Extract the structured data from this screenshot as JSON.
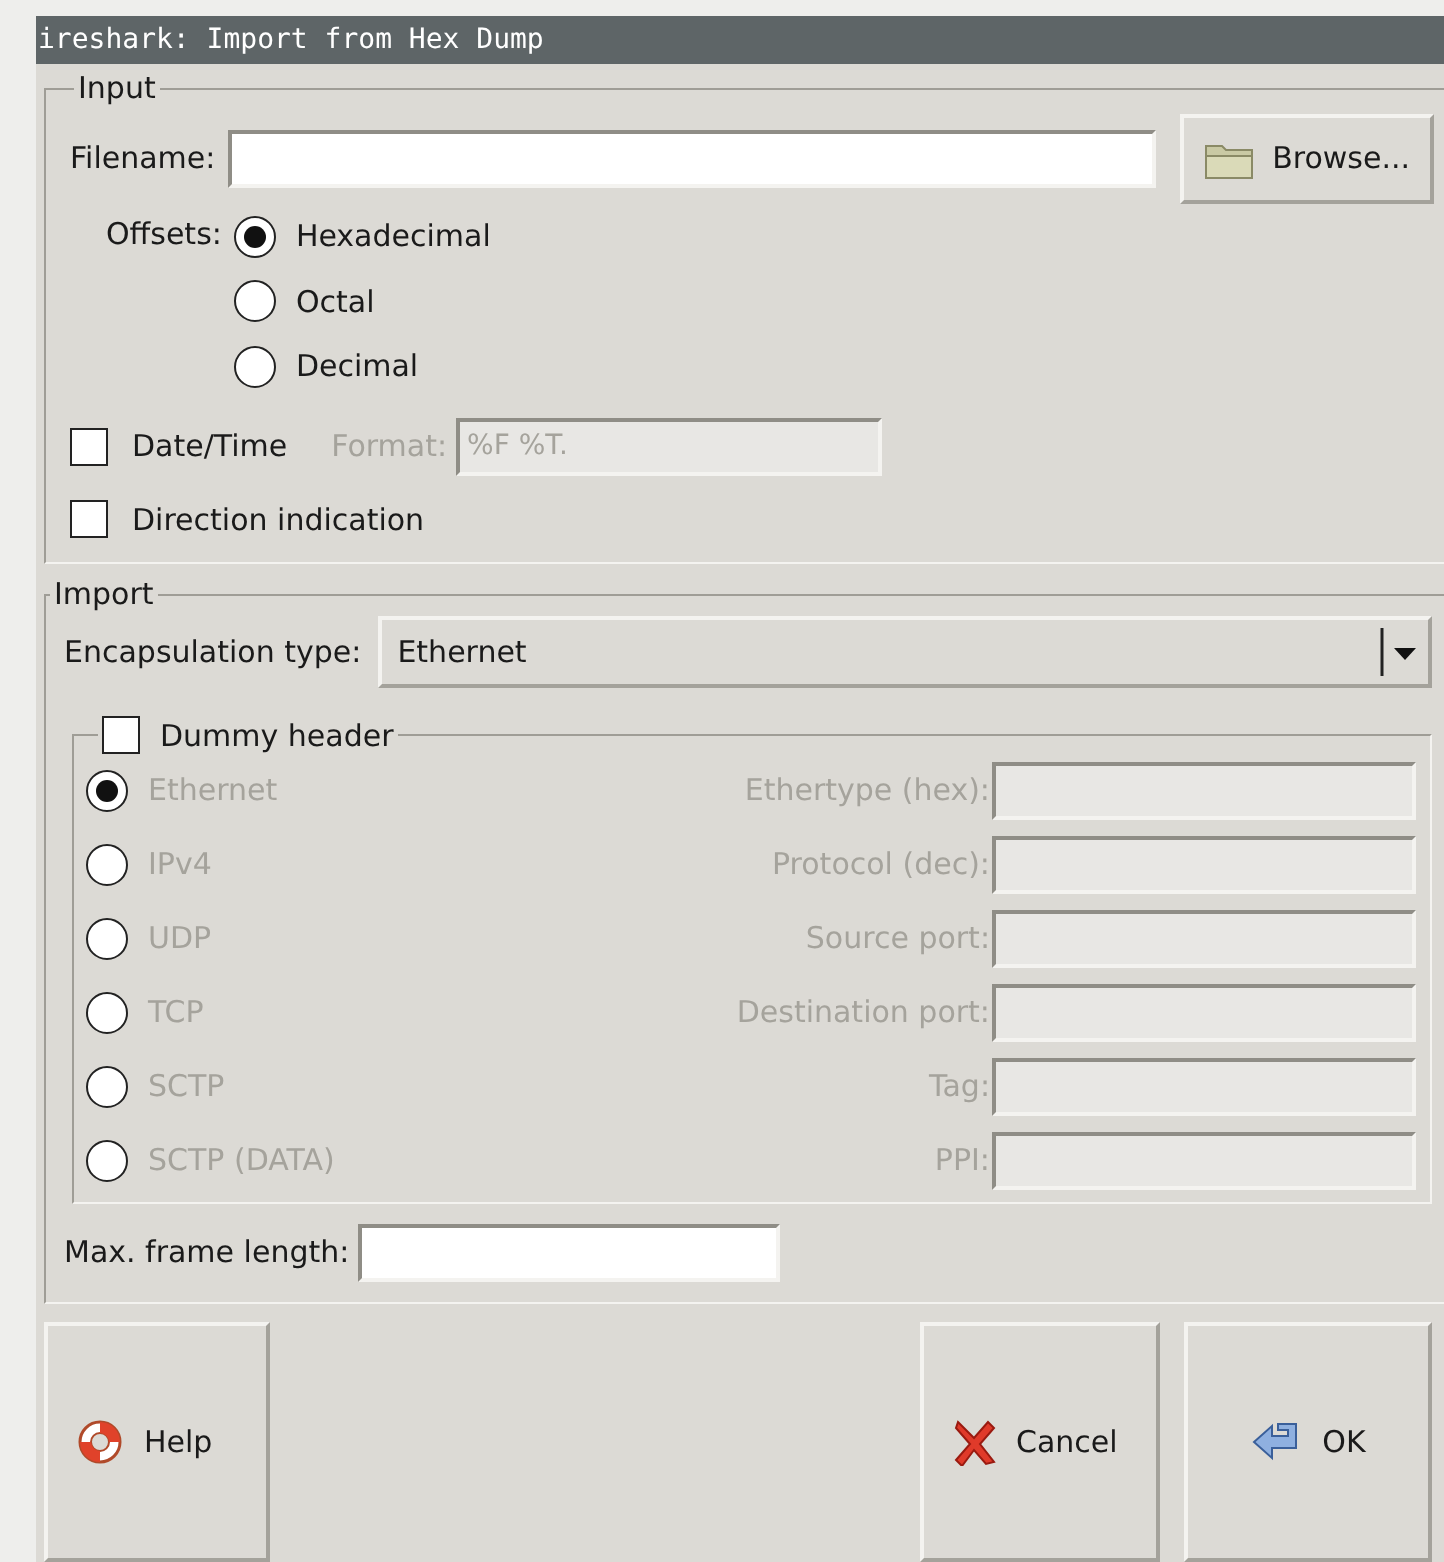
{
  "window": {
    "title": "ireshark: Import from Hex Dump"
  },
  "input": {
    "legend": "Input",
    "filename_label": "Filename:",
    "browse_button": "Browse...",
    "offsets": {
      "label": "Offsets:",
      "options": [
        {
          "label": "Hexadecimal",
          "selected": true
        },
        {
          "label": "Octal",
          "selected": false
        },
        {
          "label": "Decimal",
          "selected": false
        }
      ]
    },
    "date_time": {
      "label": "Date/Time",
      "checked": false
    },
    "format": {
      "label": "Format:",
      "value": "%F %T.",
      "disabled": true
    },
    "direction_indication": {
      "label": "Direction indication",
      "checked": false
    }
  },
  "import": {
    "legend": "Import",
    "encapsulation": {
      "label": "Encapsulation type:",
      "value": "Ethernet"
    },
    "dummy_header": {
      "label": "Dummy header",
      "checked": false,
      "rows": [
        {
          "protocol": "Ethernet",
          "selected": true,
          "field": "Ethertype (hex):",
          "disabled": true
        },
        {
          "protocol": "IPv4",
          "selected": false,
          "field": "Protocol (dec):",
          "disabled": true
        },
        {
          "protocol": "UDP",
          "selected": false,
          "field": "Source port:",
          "disabled": true
        },
        {
          "protocol": "TCP",
          "selected": false,
          "field": "Destination port:",
          "disabled": true
        },
        {
          "protocol": "SCTP",
          "selected": false,
          "field": "Tag:",
          "disabled": true
        },
        {
          "protocol": "SCTP (DATA)",
          "selected": false,
          "field": "PPI:",
          "disabled": true
        }
      ]
    },
    "max_frame_length": {
      "label": "Max. frame length:"
    }
  },
  "buttons": [
    {
      "label": "Help",
      "kind": "help"
    },
    {
      "label": "Cancel",
      "kind": "cancel"
    },
    {
      "label": "OK",
      "kind": "ok"
    }
  ]
}
